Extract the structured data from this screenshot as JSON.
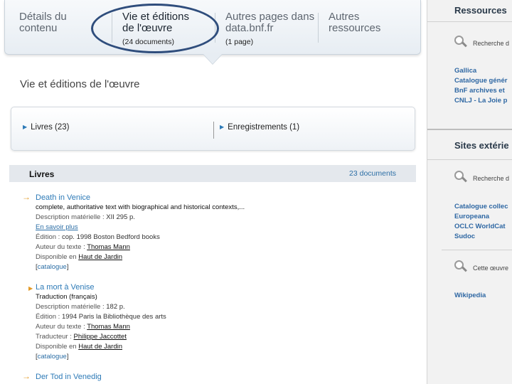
{
  "tabs": [
    {
      "label_line1": "Détails du",
      "label_line2": "contenu",
      "count": ""
    },
    {
      "label_line1": "Vie et éditions",
      "label_line2": "de l'œuvre",
      "count": "(24 documents)"
    },
    {
      "label_line1": "Autres pages dans",
      "label_line2": "data.bnf.fr",
      "count": "(1 page)"
    },
    {
      "label_line1": "Autres",
      "label_line2": "ressources",
      "count": ""
    }
  ],
  "section_title": "Vie et éditions de l'œuvre",
  "filters": {
    "books": "Livres (23)",
    "recordings": "Enregistrements (1)"
  },
  "list": {
    "label": "Livres",
    "count": "23 documents"
  },
  "records": [
    {
      "title": "Death in Venice",
      "subtitle": "complete, authoritative text with biographical and historical contexts,...",
      "desc_label": "Description matérielle : ",
      "desc_value": "XII 295 p.",
      "more": "En savoir plus",
      "edition_label": "Édition : ",
      "edition_value": "cop. 1998 Boston Bedford books",
      "author_label": "Auteur du texte : ",
      "author_value": "Thomas Mann",
      "avail_label": "Disponible en ",
      "avail_value": "Haut de Jardin",
      "catalogue": "catalogue"
    },
    {
      "title": "La mort à Venise",
      "subtitle": "Traduction (français)",
      "desc_label": "Description matérielle : ",
      "desc_value": "182 p.",
      "edition_label": "Édition : ",
      "edition_value": "1994 Paris la Bibliothèque des arts",
      "author_label": "Auteur du texte : ",
      "author_value": "Thomas Mann",
      "translator_label": "Traducteur : ",
      "translator_value": "Philippe Jaccottet",
      "avail_label": "Disponible en ",
      "avail_value": "Haut de Jardin",
      "catalogue": "catalogue"
    },
    {
      "title": "Der Tod in Venedig"
    }
  ],
  "sidebar": {
    "resources_title": "Ressources",
    "resources_search": "Recherche d",
    "resources_links": [
      "Gallica",
      "Catalogue génér",
      "BnF archives et",
      "CNLJ - La Joie p"
    ],
    "external_title": "Sites extérie",
    "external_search": "Recherche d",
    "external_links": [
      "Catalogue collec",
      "Europeana",
      "OCLC WorldCat",
      "Sudoc"
    ],
    "work_search": "Cette œuvre",
    "wiki_link": "Wikipedia"
  },
  "colors": {
    "link": "#2d7ab7",
    "arrow": "#e39a27",
    "highlight_ellipse": "#2f4d7c"
  }
}
